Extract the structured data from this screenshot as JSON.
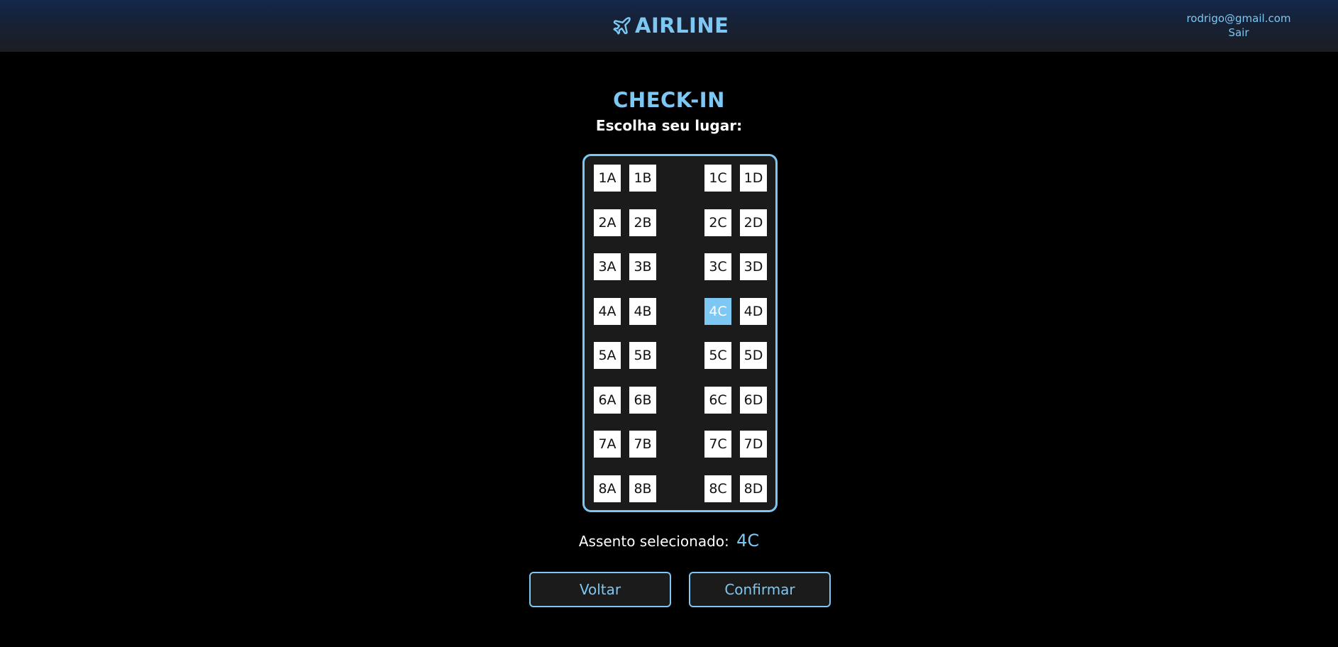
{
  "header": {
    "brand": "AIRLINE",
    "brand_icon": "airplane-icon",
    "user_email": "rodrigo@gmail.com",
    "logout_label": "Sair"
  },
  "main": {
    "title": "CHECK-IN",
    "subtitle": "Escolha seu lugar:",
    "seats": [
      [
        "1A",
        "1B",
        "1C",
        "1D"
      ],
      [
        "2A",
        "2B",
        "2C",
        "2D"
      ],
      [
        "3A",
        "3B",
        "3C",
        "3D"
      ],
      [
        "4A",
        "4B",
        "4C",
        "4D"
      ],
      [
        "5A",
        "5B",
        "5C",
        "5D"
      ],
      [
        "6A",
        "6B",
        "6C",
        "6D"
      ],
      [
        "7A",
        "7B",
        "7C",
        "7D"
      ],
      [
        "8A",
        "8B",
        "8C",
        "8D"
      ]
    ],
    "selected_seat": "4C",
    "selection_label": "Assento selecionado:",
    "selection_value": "4C",
    "back_label": "Voltar",
    "confirm_label": "Confirmar"
  },
  "colors": {
    "accent": "#7cc8f2",
    "background": "#000000",
    "panel": "#1b1b1b"
  }
}
